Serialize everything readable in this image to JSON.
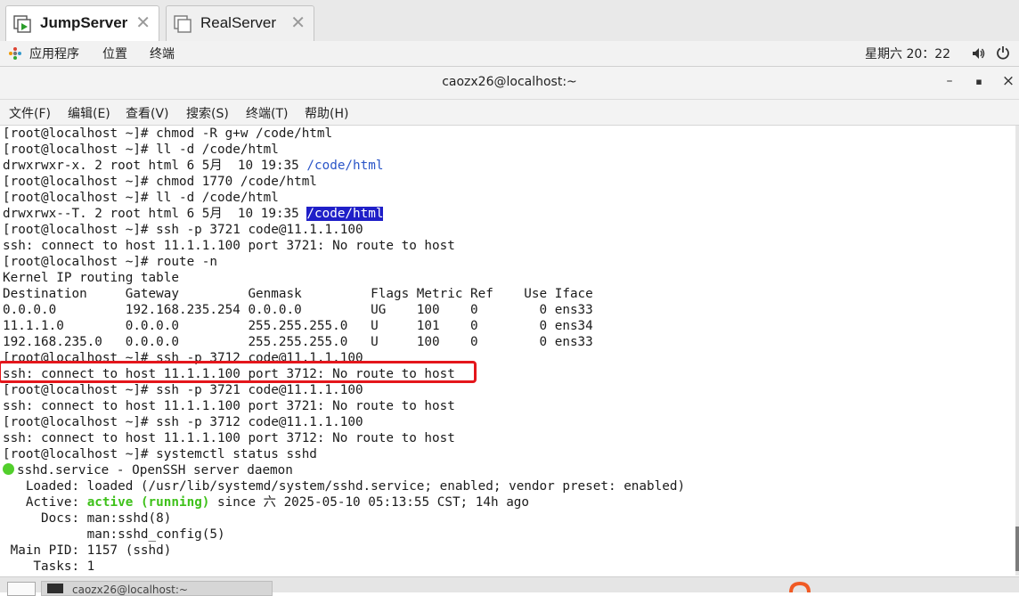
{
  "tabs": [
    {
      "label": "JumpServer",
      "active": true,
      "icon": "server-tab-icon"
    },
    {
      "label": "RealServer",
      "active": false,
      "icon": "server-tab-icon"
    }
  ],
  "topbar": {
    "apps": "应用程序",
    "places": "位置",
    "terminal": "终端",
    "clock": "星期六 20：22"
  },
  "window": {
    "title": "caozx26@localhost:~",
    "minimize": "–",
    "maximize": "▪",
    "close": "×"
  },
  "menubar": [
    "文件(F)",
    "编辑(E)",
    "查看(V)",
    "搜索(S)",
    "终端(T)",
    "帮助(H)"
  ],
  "terminal": {
    "lines": [
      "[root@localhost ~]# chmod -R g+w /code/html",
      "[root@localhost ~]# ll -d /code/html",
      "drwxrwxr-x. 2 root html 6 5月  10 19:35 ",
      "[root@localhost ~]# chmod 1770 /code/html",
      "[root@localhost ~]# ll -d /code/html",
      "drwxrwx--T. 2 root html 6 5月  10 19:35 ",
      "[root@localhost ~]# ssh -p 3721 code@11.1.1.100",
      "ssh: connect to host 11.1.1.100 port 3721: No route to host",
      "[root@localhost ~]# route -n",
      "Kernel IP routing table",
      "Destination     Gateway         Genmask         Flags Metric Ref    Use Iface",
      "0.0.0.0         192.168.235.254 0.0.0.0         UG    100    0        0 ens33",
      "11.1.1.0        0.0.0.0         255.255.255.0   U     101    0        0 ens34",
      "192.168.235.0   0.0.0.0         255.255.255.0   U     100    0        0 ens33",
      "[root@localhost ~]# ssh -p 3712 code@11.1.1.100",
      "ssh: connect to host 11.1.1.100 port 3712: No route to host",
      "[root@localhost ~]# ssh -p 3721 code@11.1.1.100",
      "ssh: connect to host 11.1.1.100 port 3721: No route to host",
      "[root@localhost ~]# ssh -p 3712 code@11.1.1.100",
      "ssh: connect to host 11.1.1.100 port 3712: No route to host",
      "[root@localhost ~]# systemctl status sshd",
      "sshd.service - OpenSSH server daemon",
      "   Loaded: loaded (/usr/lib/systemd/system/sshd.service; enabled; vendor preset: enabled)",
      "   Active: ",
      "     Docs: man:sshd(8)",
      "           man:sshd_config(5)",
      " Main PID: 1157 (sshd)",
      "    Tasks: 1"
    ],
    "path_link": "/code/html",
    "path_selected": "/code/html",
    "active_state": "active (running)",
    "active_rest": " since 六 2025-05-10 05:13:55 CST; 14h ago"
  },
  "taskbar": {
    "window_label": "caozx26@localhost:~"
  },
  "colors": {
    "highlight_box": "#e4161b",
    "link": "#2a55c8",
    "selection": "#1f1fc8",
    "active_green": "#3ec11a"
  }
}
